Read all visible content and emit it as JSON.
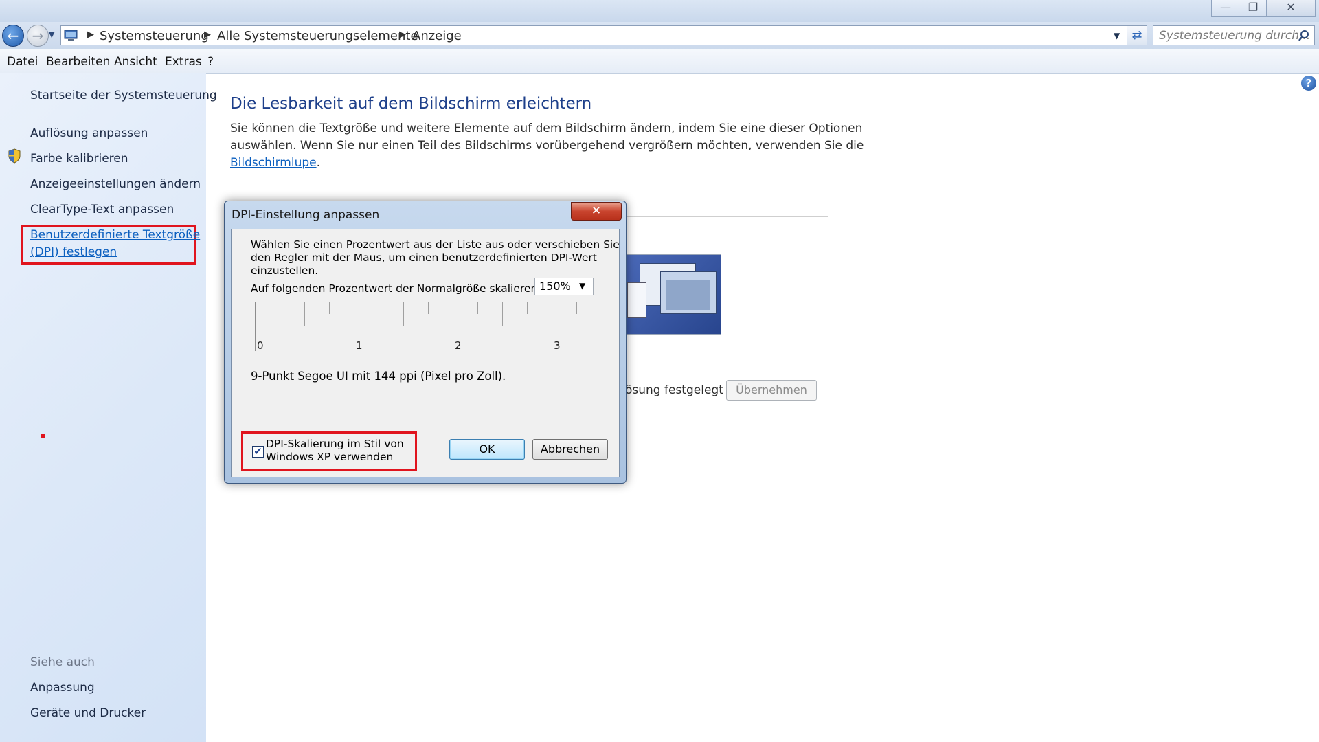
{
  "window": {
    "minimize": "—",
    "maximize": "❐",
    "close": "✕"
  },
  "address": {
    "crumbs": [
      "Systemsteuerung",
      "Alle Systemsteuerungselemente",
      "Anzeige"
    ],
    "search_placeholder": "Systemsteuerung durch..."
  },
  "menu": [
    "Datei",
    "Bearbeiten",
    "Ansicht",
    "Extras",
    "?"
  ],
  "sidebar": {
    "home": "Startseite der Systemsteuerung",
    "items": [
      "Auflösung anpassen",
      "Farbe kalibrieren",
      "Anzeigeeinstellungen ändern",
      "ClearType-Text anpassen",
      "Benutzerdefinierte Textgröße",
      "(DPI) festlegen"
    ],
    "see_also_heading": "Siehe auch",
    "see_also": [
      "Anpassung",
      "Geräte und Drucker"
    ]
  },
  "main": {
    "title": "Die Lesbarkeit auf dem Bildschirm erleichtern",
    "intro_line1": "Sie können die Textgröße und weitere Elemente auf dem Bildschirm ändern, indem Sie eine dieser Optionen",
    "intro_line2": "auswählen. Wenn Sie nur einen Teil des Bildschirms vorübergehend vergrößern möchten, verwenden Sie die",
    "intro_link": "Bildschirmlupe",
    "intro_end": ".",
    "partial_text": "ösung festgelegt",
    "apply_button": "Übernehmen"
  },
  "dialog": {
    "title": "DPI-Einstellung anpassen",
    "close": "✕",
    "desc_line1": "Wählen Sie einen Prozentwert aus der Liste aus oder verschieben Sie",
    "desc_line2": "den Regler mit der Maus, um einen benutzerdefinierten DPI-Wert",
    "desc_line3": "einzustellen.",
    "scale_label": "Auf folgenden Prozentwert der Normalgröße skalieren:",
    "scale_value": "150%",
    "ruler_labels": [
      "0",
      "1",
      "2",
      "3"
    ],
    "info": "9-Punkt Segoe UI mit 144 ppi (Pixel pro Zoll).",
    "checkbox_line1": "DPI-Skalierung im Stil von",
    "checkbox_line2": "Windows XP verwenden",
    "checkbox_checked": true,
    "ok": "OK",
    "cancel": "Abbrechen"
  },
  "colors": {
    "highlight_box": "#e0141e",
    "link": "#0b5fbf",
    "title_blue": "#1d3f8a"
  }
}
